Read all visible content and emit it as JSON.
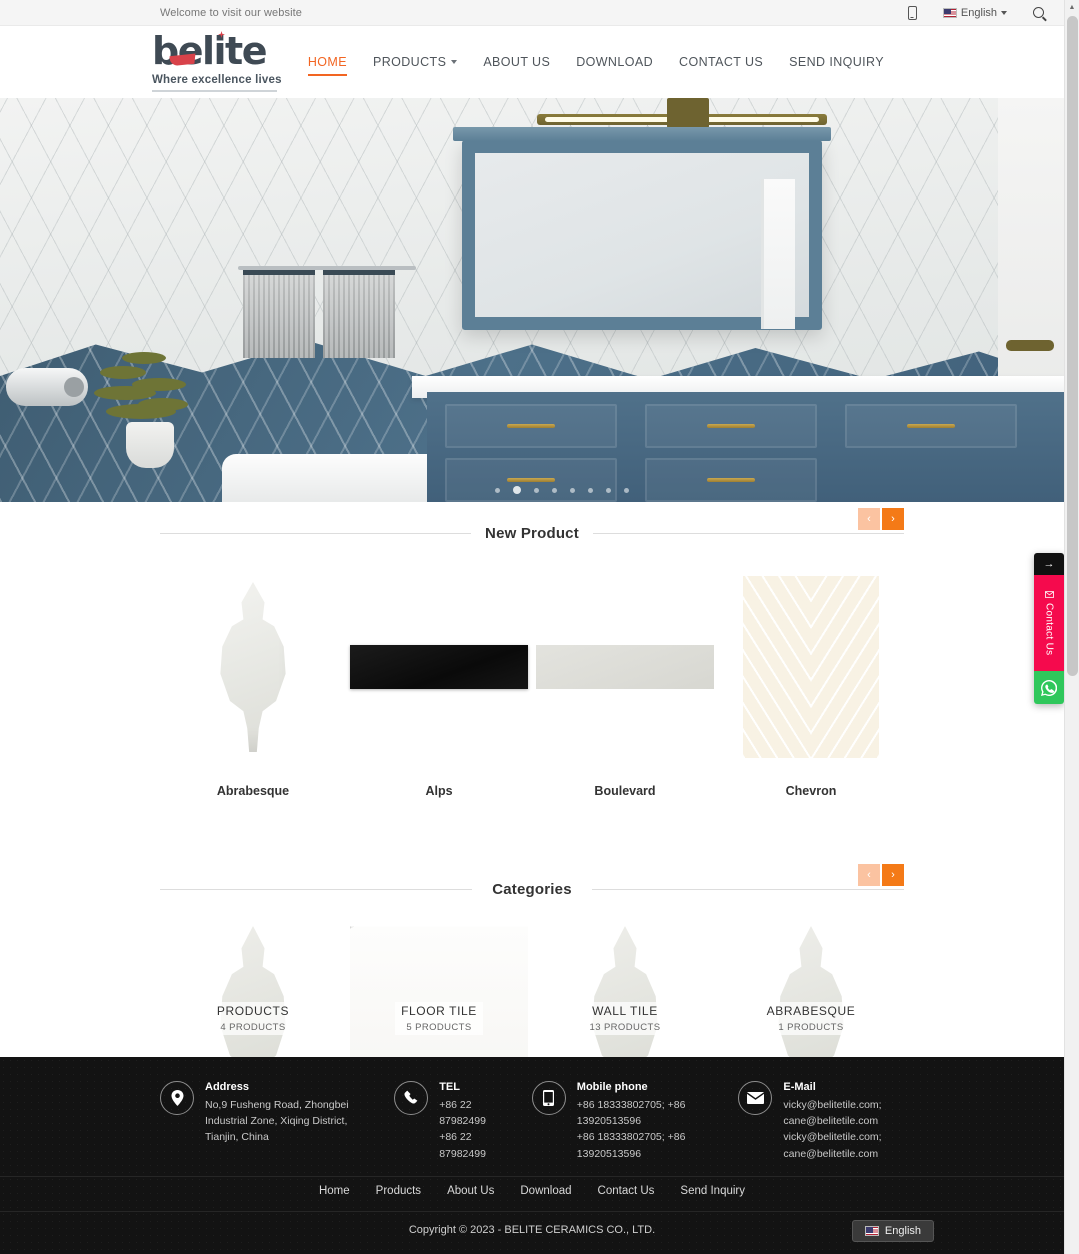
{
  "topbar": {
    "welcome": "Welcome to visit our website",
    "mobile_icon": "mobile-phone-icon",
    "language": "English",
    "search_icon": "search-icon"
  },
  "header": {
    "logo_text": "belite",
    "logo_tagline": "Where excellence lives",
    "nav": [
      {
        "label": "HOME",
        "active": true
      },
      {
        "label": "PRODUCTS",
        "has_dropdown": true
      },
      {
        "label": "ABOUT US"
      },
      {
        "label": "DOWNLOAD"
      },
      {
        "label": "CONTACT US"
      },
      {
        "label": "SEND INQUIRY"
      }
    ]
  },
  "hero": {
    "alt": "Bathroom interior with white herringbone wall tile, blue chevron tile, blue vanity and mirror",
    "slide_count": 8,
    "active_slide": 2
  },
  "new_product": {
    "title": "New Product",
    "prev_label": "‹",
    "next_label": "›",
    "items": [
      {
        "name": "Abrabesque",
        "style": "arabesque"
      },
      {
        "name": "Alps",
        "style": "black"
      },
      {
        "name": "Boulevard",
        "style": "beige"
      },
      {
        "name": "Chevron",
        "style": "chevron"
      }
    ]
  },
  "categories": {
    "title": "Categories",
    "prev_label": "‹",
    "next_label": "›",
    "items": [
      {
        "name": "PRODUCTS",
        "count": "4 PRODUCTS",
        "style": "tile"
      },
      {
        "name": "FLOOR TILE",
        "count": "5 PRODUCTS",
        "style": "marble"
      },
      {
        "name": "WALL TILE",
        "count": "13 PRODUCTS",
        "style": "tile"
      },
      {
        "name": "ABRABESQUE",
        "count": "1 PRODUCTS",
        "style": "tile"
      }
    ]
  },
  "footer": {
    "contacts": [
      {
        "icon": "location-pin-icon",
        "title": "Address",
        "text": "No,9 Fusheng Road, Zhongbei Industrial Zone, Xiqing District, Tianjin, China"
      },
      {
        "icon": "phone-icon",
        "title": "TEL",
        "text": "+86 22 87982499\n+86 22 87982499"
      },
      {
        "icon": "mobile-phone-icon",
        "title": "Mobile phone",
        "text": "+86 18333802705; +86 13920513596\n+86 18333802705; +86 13920513596"
      },
      {
        "icon": "envelope-icon",
        "title": "E-Mail",
        "text": "vicky@belitetile.com; cane@belitetile.com\nvicky@belitetile.com; cane@belitetile.com"
      }
    ],
    "nav": [
      "Home",
      "Products",
      "About Us",
      "Download",
      "Contact Us",
      "Send Inquiry"
    ],
    "copyright": "Copyright © 2023 - BELITE CERAMICS CO., LTD.",
    "language": "English"
  },
  "float_widget": {
    "collapse_label": "→",
    "contact_label": "Contact Us",
    "whatsapp_icon": "whatsapp-icon"
  },
  "colors": {
    "accent_orange": "#f26522",
    "carousel_next": "#f47a17",
    "carousel_prev": "#fbc3a1",
    "contact_pink": "#f50a4d",
    "whatsapp_green": "#2fc75b",
    "logo_dark": "#3f4a54",
    "logo_red": "#d8424a",
    "footer_bg": "#131313",
    "tile_blue": "#4d7089"
  }
}
